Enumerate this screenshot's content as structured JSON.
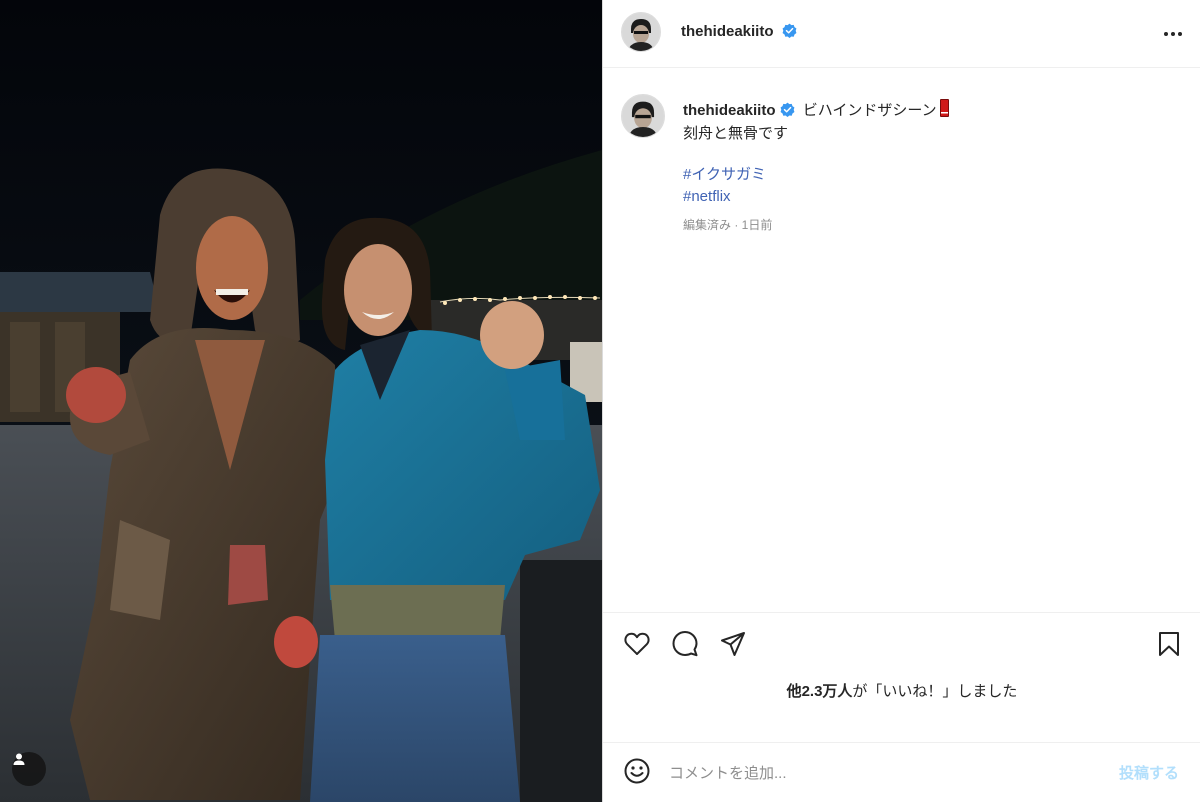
{
  "post": {
    "username": "thehideakiito",
    "verified": true,
    "caption_title": "ビハインドザシーン",
    "caption_line2": "刻舟と無骨です",
    "hashtags": [
      "#イクサガミ",
      "#netflix"
    ],
    "meta": "編集済み · 1日前"
  },
  "icons": {
    "verified": "verified-badge-icon",
    "more": "more-options-icon",
    "like": "heart-icon",
    "comment": "comment-icon",
    "share": "share-icon",
    "save": "bookmark-icon",
    "emoji": "emoji-icon",
    "tagged_users": "user-icon"
  },
  "likes": {
    "count": "他2.3万人",
    "suffix": "が「いいね！」しました"
  },
  "comment": {
    "placeholder": "コメントを追加...",
    "post_label": "投稿する"
  },
  "colors": {
    "verified": "#3897f0",
    "hashtag": "#4063b4",
    "post_button": "#b2dffc",
    "meta": "#8e8e8e"
  }
}
